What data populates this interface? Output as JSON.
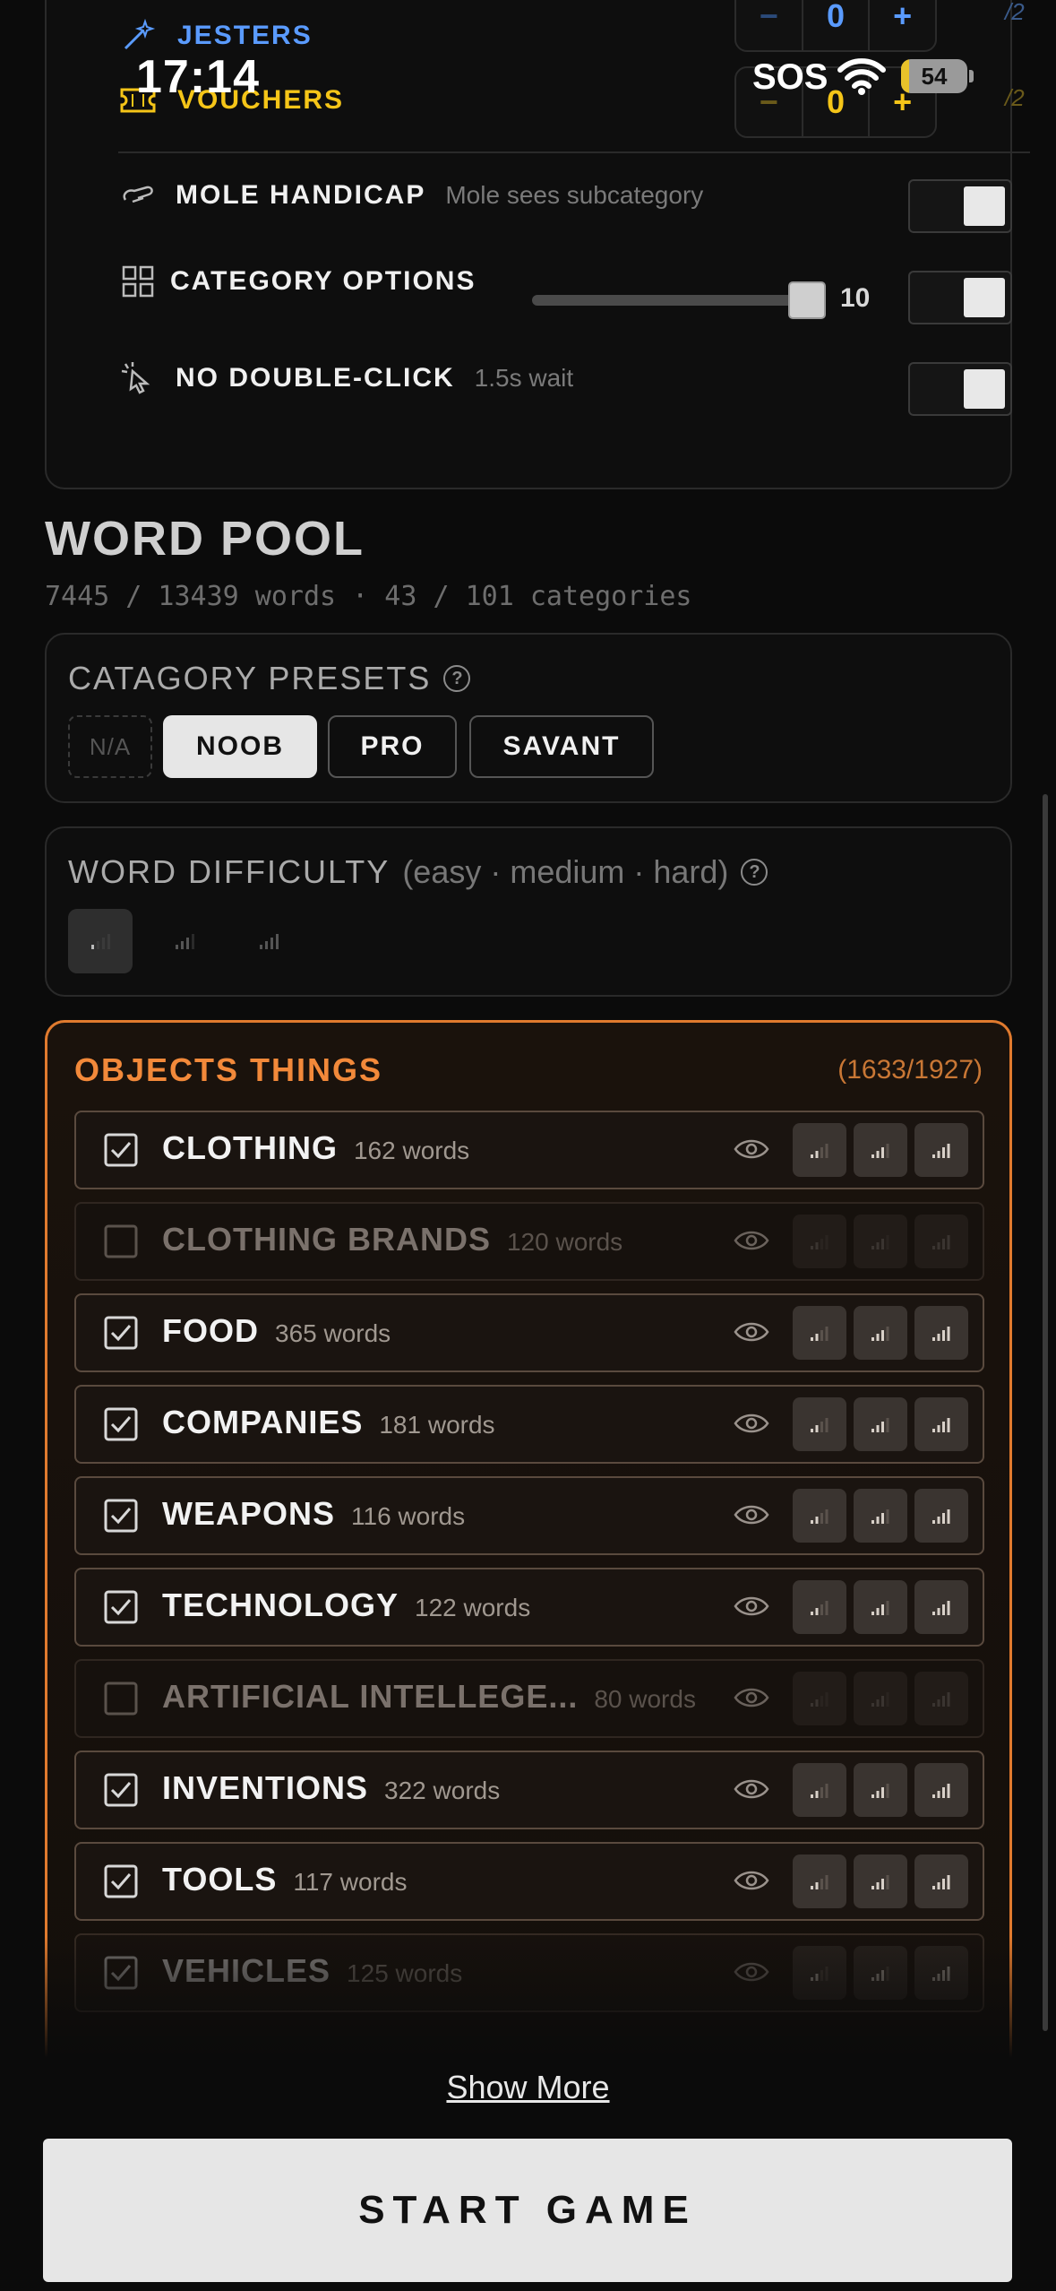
{
  "status": {
    "time": "17:14",
    "sos": "SOS",
    "battery": "54",
    "battery_level": 0.54
  },
  "roles": {
    "jesters": {
      "label": "JESTERS",
      "count": "0",
      "minus": "−",
      "plus": "+",
      "max": "/2",
      "color": "#5a9bff"
    },
    "vouchers": {
      "label": "VOUCHERS",
      "count": "0",
      "minus": "−",
      "plus": "+",
      "max": "/2",
      "color": "#f5c518"
    }
  },
  "options": {
    "mole_handicap": {
      "label": "MOLE HANDICAP",
      "sub": "Mole sees subcategory",
      "on": true
    },
    "category_options": {
      "label": "CATEGORY OPTIONS",
      "slider_value": "10",
      "on": true
    },
    "no_double_click": {
      "label": "NO DOUBLE-CLICK",
      "sub": "1.5s wait",
      "on": true
    }
  },
  "word_pool": {
    "title": "WORD POOL",
    "stats": "7445 / 13439 words · 43 / 101 categories"
  },
  "presets": {
    "heading": "CATAGORY PRESETS",
    "help": "?",
    "items": [
      {
        "label": "N/A",
        "state": "disabled"
      },
      {
        "label": "NOOB",
        "state": "selected"
      },
      {
        "label": "PRO",
        "state": "normal"
      },
      {
        "label": "SAVANT",
        "state": "normal"
      }
    ]
  },
  "difficulty": {
    "heading": "WORD DIFFICULTY",
    "sub": "(easy · medium · hard)",
    "help": "?",
    "selected": "easy"
  },
  "category": {
    "title": "OBJECTS THINGS",
    "count": "(1633/1927)",
    "accent": "#f2893a",
    "items": [
      {
        "label": "CLOTHING",
        "words": "162 words",
        "checked": true
      },
      {
        "label": "CLOTHING BRANDS",
        "words": "120 words",
        "checked": false
      },
      {
        "label": "FOOD",
        "words": "365 words",
        "checked": true
      },
      {
        "label": "COMPANIES",
        "words": "181 words",
        "checked": true
      },
      {
        "label": "WEAPONS",
        "words": "116 words",
        "checked": true
      },
      {
        "label": "TECHNOLOGY",
        "words": "122 words",
        "checked": true
      },
      {
        "label": "ARTIFICIAL INTELLEGE...",
        "words": "80 words",
        "checked": false
      },
      {
        "label": "INVENTIONS",
        "words": "322 words",
        "checked": true
      },
      {
        "label": "TOOLS",
        "words": "117 words",
        "checked": true
      },
      {
        "label": "VEHICLES",
        "words": "125 words",
        "checked": true
      }
    ]
  },
  "show_more": "Show More",
  "start_game": "START GAME"
}
